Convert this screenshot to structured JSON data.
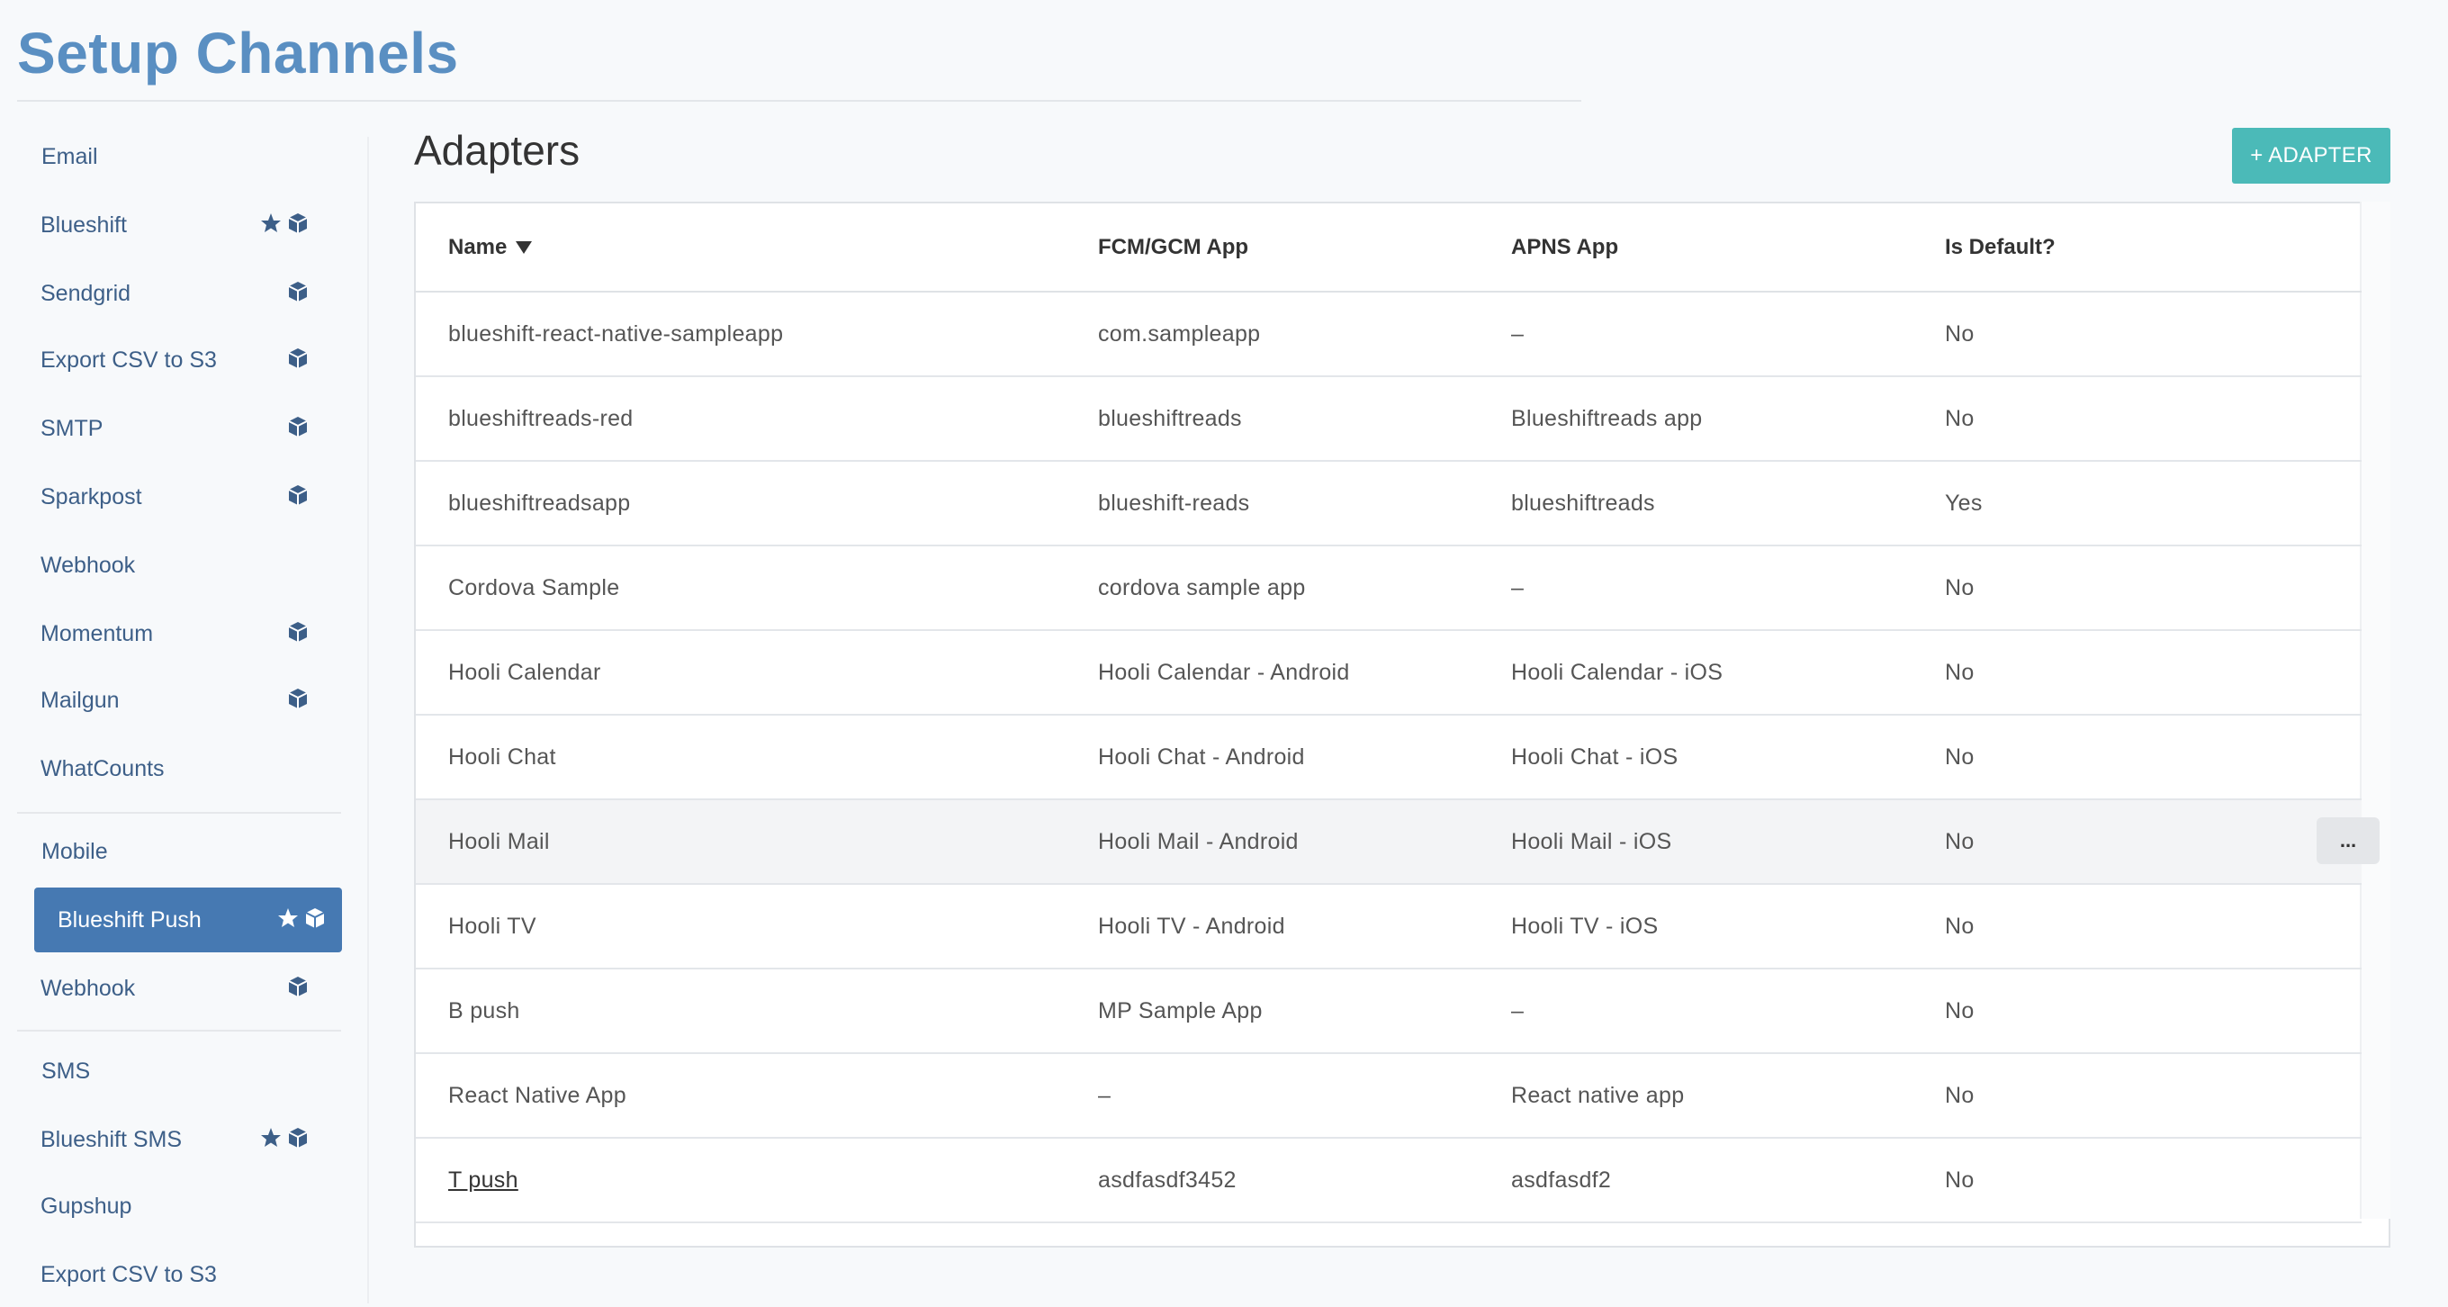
{
  "page": {
    "title": "Setup Channels"
  },
  "sidebar": {
    "groups": [
      {
        "label": "Email",
        "items": [
          {
            "label": "Blueshift",
            "star": true,
            "cube": true
          },
          {
            "label": "Sendgrid",
            "cube": true
          },
          {
            "label": "Export CSV to S3",
            "cube": true
          },
          {
            "label": "SMTP",
            "cube": true
          },
          {
            "label": "Sparkpost",
            "cube": true
          },
          {
            "label": "Webhook"
          },
          {
            "label": "Momentum",
            "cube": true
          },
          {
            "label": "Mailgun",
            "cube": true
          },
          {
            "label": "WhatCounts"
          }
        ]
      },
      {
        "label": "Mobile",
        "items": [
          {
            "label": "Blueshift Push",
            "star": true,
            "cube": true,
            "active": true
          },
          {
            "label": "Webhook",
            "cube": true
          }
        ]
      },
      {
        "label": "SMS",
        "items": [
          {
            "label": "Blueshift SMS",
            "star": true,
            "cube": true
          },
          {
            "label": "Gupshup"
          },
          {
            "label": "Export CSV to S3"
          }
        ]
      }
    ]
  },
  "main": {
    "title": "Adapters",
    "add_button": "+ ADAPTER",
    "more_button": "...",
    "columns": [
      "Name",
      "FCM/GCM App",
      "APNS App",
      "Is Default?"
    ],
    "rows": [
      [
        "blueshift-react-native-sampleapp",
        "com.sampleapp",
        "–",
        "No"
      ],
      [
        "blueshiftreads-red",
        "blueshiftreads",
        "Blueshiftreads app",
        "No"
      ],
      [
        "blueshiftreadsapp",
        "blueshift-reads",
        "blueshiftreads",
        "Yes"
      ],
      [
        "Cordova Sample",
        "cordova sample app",
        "–",
        "No"
      ],
      [
        "Hooli Calendar",
        "Hooli Calendar - Android",
        "Hooli Calendar - iOS",
        "No"
      ],
      [
        "Hooli Chat",
        "Hooli Chat - Android",
        "Hooli Chat - iOS",
        "No"
      ],
      [
        "Hooli Mail",
        "Hooli Mail - Android",
        "Hooli Mail - iOS",
        "No"
      ],
      [
        "Hooli TV",
        "Hooli TV - Android",
        "Hooli TV - iOS",
        "No"
      ],
      [
        "B push",
        "MP Sample App",
        "–",
        "No"
      ],
      [
        "React Native App",
        "–",
        "React native app",
        "No"
      ],
      [
        "T push",
        "asdfasdf3452",
        "asdfasdf2",
        "No"
      ]
    ]
  },
  "colors": {
    "brand": "#5a8fc2",
    "active": "#4679b2",
    "accent": "#4bbab8"
  }
}
